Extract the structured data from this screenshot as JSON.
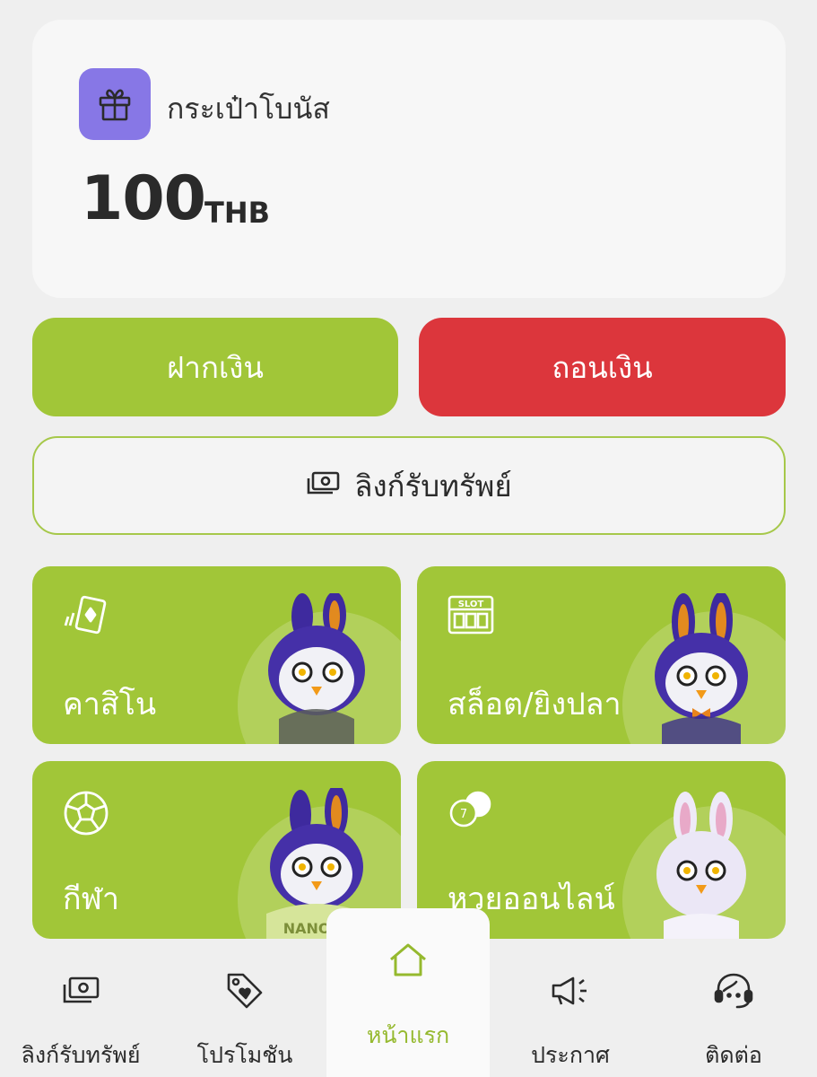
{
  "wallet": {
    "icon": "gift-icon",
    "label": "กระเป๋าโบนัส",
    "amount": "100",
    "currency": "THB",
    "accent": "#8777e6"
  },
  "actions": {
    "deposit_label": "ฝากเงิน",
    "withdraw_label": "ถอนเงิน",
    "deposit_color": "#a1c638",
    "withdraw_color": "#dc363c"
  },
  "asset_link": {
    "icon": "cash-icon",
    "label": "ลิงก์รับทรัพย์"
  },
  "games": [
    {
      "label": "คาสิโน",
      "icon": "cards-icon"
    },
    {
      "label": "สล็อต/ยิงปลา",
      "icon": "slot-icon",
      "icon_text": "SLOT"
    },
    {
      "label": "กีฬา",
      "icon": "soccer-ball-icon"
    },
    {
      "label": "หวยออนไลน์",
      "icon": "lottery-balls-icon",
      "icon_text": "7"
    }
  ],
  "mascot_text": "NANOEE",
  "nav": {
    "items": [
      {
        "label": "ลิงก์รับทรัพย์",
        "icon": "cash-icon"
      },
      {
        "label": "โปรโมชัน",
        "icon": "tag-heart-icon"
      },
      {
        "label": "หน้าแรก",
        "icon": "home-icon",
        "active": true
      },
      {
        "label": "ประกาศ",
        "icon": "megaphone-icon"
      },
      {
        "label": "ติดต่อ",
        "icon": "headset-icon"
      }
    ],
    "active_color": "#95b92e"
  }
}
